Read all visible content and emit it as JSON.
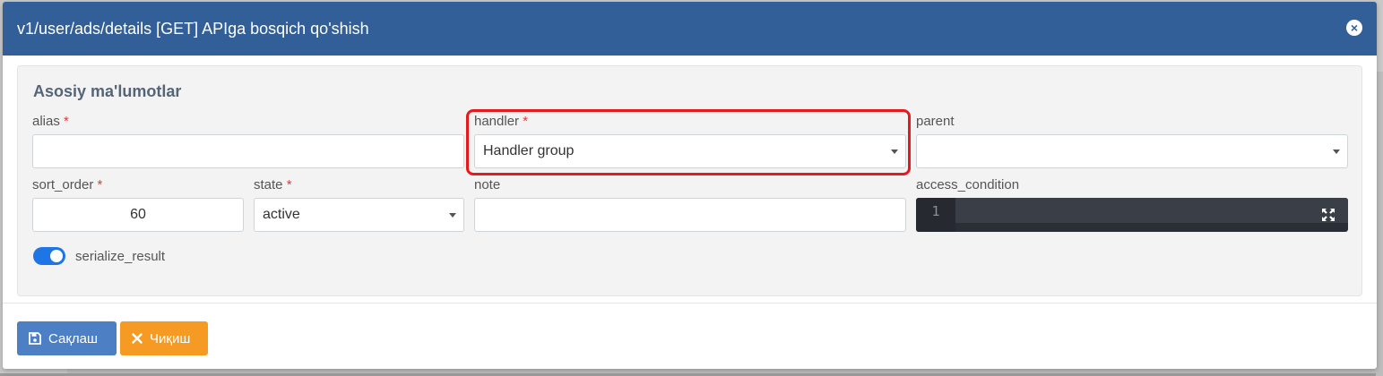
{
  "modal": {
    "title": "v1/user/ads/details [GET] APIga bosqich qo'shish"
  },
  "section": {
    "title": "Asosiy ma'lumotlar"
  },
  "fields": {
    "alias": {
      "label": "alias",
      "required": "*",
      "value": ""
    },
    "handler": {
      "label": "handler",
      "required": "*",
      "value": "Handler group"
    },
    "parent": {
      "label": "parent",
      "value": ""
    },
    "sort_order": {
      "label": "sort_order",
      "required": "*",
      "value": "60"
    },
    "state": {
      "label": "state",
      "required": "*",
      "value": "active"
    },
    "note": {
      "label": "note",
      "value": ""
    },
    "access_condition": {
      "label": "access_condition",
      "line_number": "1"
    }
  },
  "toggle": {
    "label": "serialize_result",
    "checked": true
  },
  "buttons": {
    "save": "Сақлаш",
    "exit": "Чиқиш"
  },
  "colors": {
    "header": "#335f99",
    "save": "#4d7fc4",
    "exit": "#f59a23",
    "toggle": "#1f74e6",
    "highlight": "#e6191c"
  },
  "icons": {
    "close": "close-circle-icon",
    "save": "floppy-disk-icon",
    "exit": "x-icon",
    "fullscreen": "expand-icon",
    "dropdown": "caret-down-icon"
  }
}
